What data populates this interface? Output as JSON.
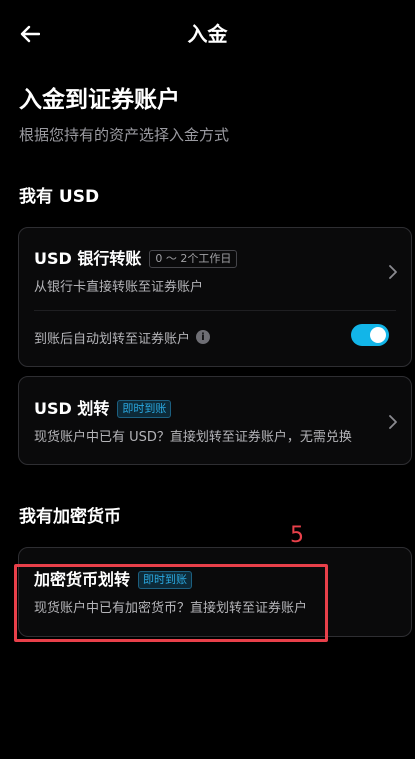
{
  "header": {
    "back_icon": "arrow-left-icon",
    "title": "入金"
  },
  "page": {
    "title": "入金到证券账户",
    "subtitle": "根据您持有的资产选择入金方式"
  },
  "sections": {
    "usd": {
      "title": "我有 USD",
      "bank_card": {
        "title": "USD 银行转账",
        "badge": "0 ～ 2个工作日",
        "desc": "从银行卡直接转账至证券账户",
        "auto_label": "到账后自动划转至证券账户",
        "info_icon": "info-icon",
        "toggle_on": true
      },
      "transfer_card": {
        "title": "USD 划转",
        "badge": "即时到账",
        "desc": "现货账户中已有 USD？直接划转至证券账户，无需兑换"
      }
    },
    "crypto": {
      "title": "我有加密货币",
      "card": {
        "title": "加密货币划转",
        "badge": "即时到账",
        "desc": "现货账户中已有加密货币？直接划转至证券账户"
      }
    }
  },
  "annotation": {
    "step": "5",
    "color": "#e8404a"
  },
  "colors": {
    "accent": "#12b5e8",
    "background": "#000000"
  }
}
